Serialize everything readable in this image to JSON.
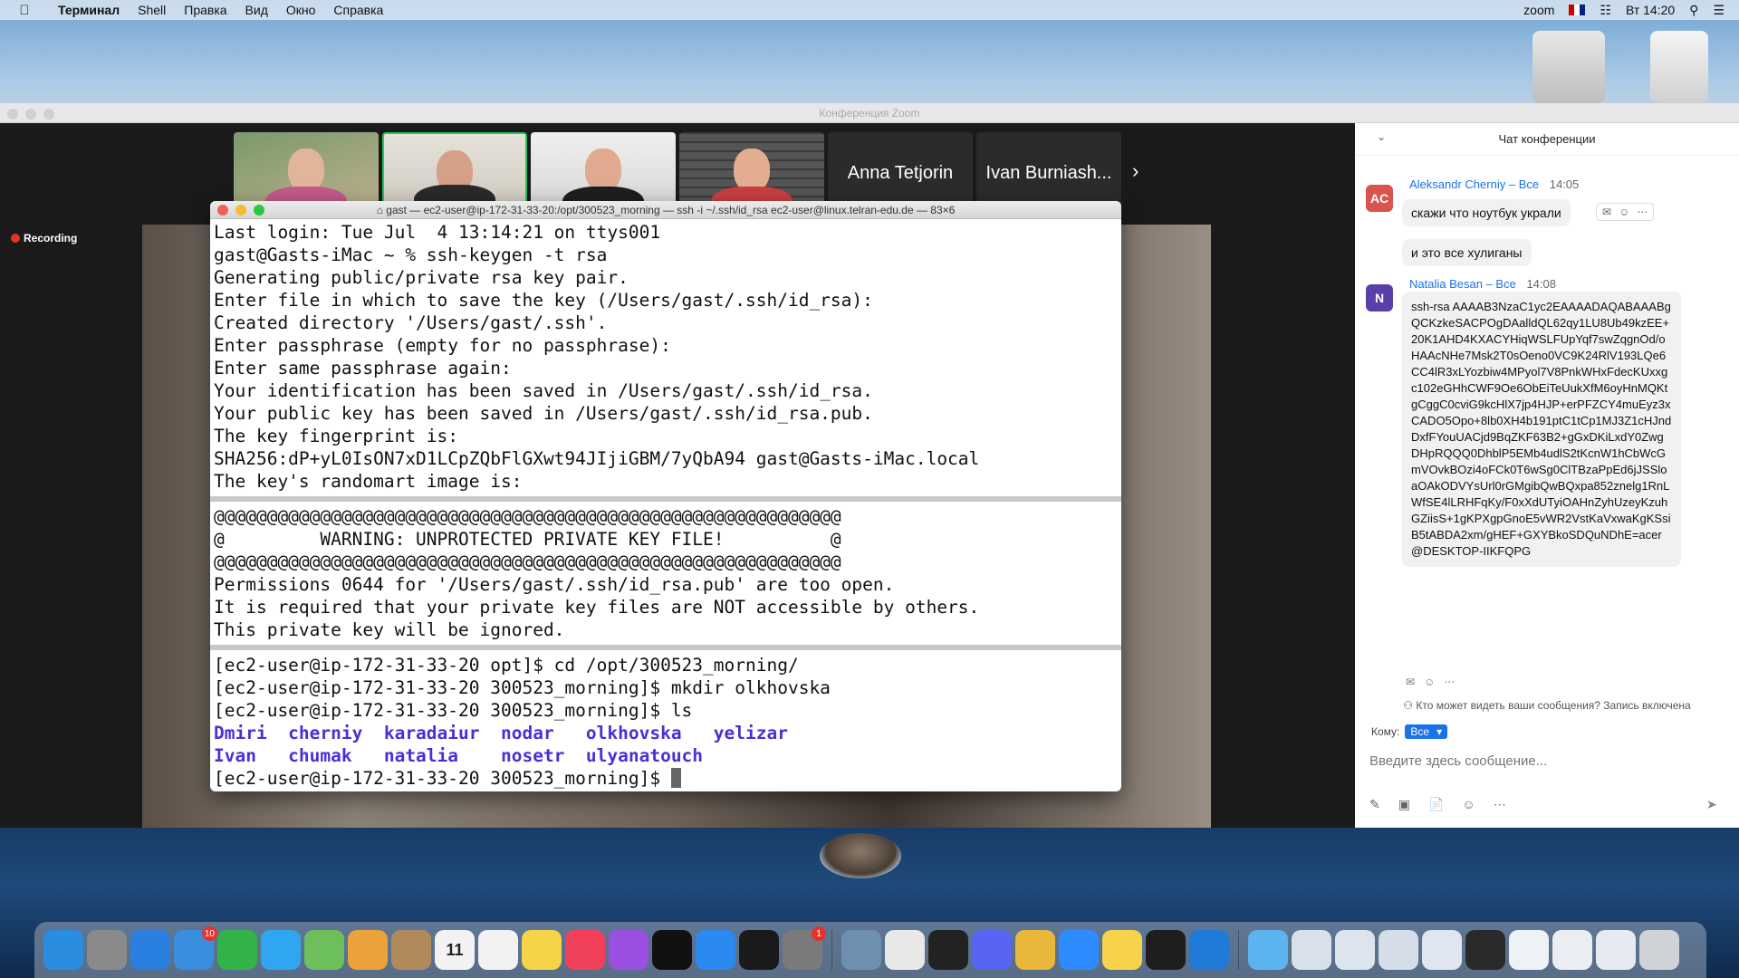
{
  "menubar": {
    "app": "Терминал",
    "items": [
      "Shell",
      "Правка",
      "Вид",
      "Окно",
      "Справка"
    ],
    "right": {
      "zoom": "zoom",
      "clock": "Вт 14:20"
    }
  },
  "zoom_window": {
    "title": "Конференция Zoom",
    "recording": "Recording",
    "participants": [
      {
        "type": "video"
      },
      {
        "type": "video",
        "active": true
      },
      {
        "type": "video"
      },
      {
        "type": "video"
      },
      {
        "type": "name",
        "name": "Anna Tetjorin"
      },
      {
        "type": "name",
        "name": "Ivan Burniash..."
      }
    ]
  },
  "terminal": {
    "title": "gast — ec2-user@ip-172-31-33-20:/opt/300523_morning — ssh -i ~/.ssh/id_rsa ec2-user@linux.telran-edu.de — 83×6",
    "section1": [
      "Last login: Tue Jul  4 13:14:21 on ttys001",
      "gast@Gasts-iMac ~ % ssh-keygen -t rsa",
      "Generating public/private rsa key pair.",
      "Enter file in which to save the key (/Users/gast/.ssh/id_rsa):",
      "Created directory '/Users/gast/.ssh'.",
      "Enter passphrase (empty for no passphrase):",
      "Enter same passphrase again:",
      "Your identification has been saved in /Users/gast/.ssh/id_rsa.",
      "Your public key has been saved in /Users/gast/.ssh/id_rsa.pub.",
      "The key fingerprint is:",
      "SHA256:dP+yL0IsON7xD1LCpZQbFlGXwt94JIjiGBM/7yQbA94 gast@Gasts-iMac.local",
      "The key's randomart image is:"
    ],
    "section2": [
      "@@@@@@@@@@@@@@@@@@@@@@@@@@@@@@@@@@@@@@@@@@@@@@@@@@@@@@@@@@@",
      "@         WARNING: UNPROTECTED PRIVATE KEY FILE!          @",
      "@@@@@@@@@@@@@@@@@@@@@@@@@@@@@@@@@@@@@@@@@@@@@@@@@@@@@@@@@@@",
      "Permissions 0644 for '/Users/gast/.ssh/id_rsa.pub' are too open.",
      "It is required that your private key files are NOT accessible by others.",
      "This private key will be ignored."
    ],
    "section3": [
      "[ec2-user@ip-172-31-33-20 opt]$ cd /opt/300523_morning/",
      "[ec2-user@ip-172-31-33-20 300523_morning]$ mkdir olkhovska",
      "[ec2-user@ip-172-31-33-20 300523_morning]$ ls"
    ],
    "ls_output": [
      "Dmiri  cherniy  karadaiur  nodar   olkhovska   yelizar",
      "Ivan   chumak   natalia    nosetr  ulyanatouch"
    ],
    "prompt": "[ec2-user@ip-172-31-33-20 300523_morning]$ "
  },
  "chat": {
    "title": "Чат конференции",
    "messages": [
      {
        "initials": "AC",
        "avatar_color": "#d9534f",
        "sender": "Aleksandr Cherniy",
        "to": "Все",
        "time": "14:05",
        "lines": [
          "скажи что ноутбук украли",
          "и это все хулиганы"
        ]
      },
      {
        "initials": "N",
        "avatar_color": "#5b3fa8",
        "sender": "Natalia Besan",
        "to": "Все",
        "time": "14:08",
        "text": "ssh-rsa AAAAB3NzaC1yc2EAAAADAQABAAABgQCKzkeSACPOgDAalldQL62qy1LU8Ub49kzEE+20K1AHD4KXACYHiqWSLFUpYqf7swZqgnOd/oHAAcNHe7Msk2T0sOeno0VC9K24RlV193LQe6CC4lR3xLYozbiw4MPyol7V8PnkWHxFdecKUxxgc102eGHhCWF9Oe6ObEiTeUukXfM6oyHnMQKtgCggC0cviG9kcHlX7jp4HJP+erPFZCY4muEyz3xCADO5Opo+8lb0XH4b191ptC1tCp1MJ3Z1cHJndDxfFYouUACjd9BqZKF63B2+gGxDKiLxdY0ZwgDHpRQQQ0DhblP5EMb4udlS2tKcnW1hCbWcGmVOvkBOzi4oFCk0T6wSg0ClTBzaPpEd6jJSSloaOAkODVYsUrl0rGMgibQwBQxpa852znelg1RnLWfSE4lLRHFqKy/F0xXdUTyiOAHnZyhUzeyKzuhGZiisS+1gKPXgpGnoE5vWR2VstKaVxwaKgKSsiB5tABDA2xm/gHEF+GXYBkoSDQuNDhE=acer@DESKTOP-IIKFQPG"
      }
    ],
    "notice": "Кто может видеть ваши сообщения? Запись включена",
    "to_label": "Кому:",
    "to_value": "Все",
    "input_placeholder": "Введите здесь сообщение..."
  },
  "dock": {
    "icons": [
      {
        "name": "finder-icon",
        "color": "#2b8de0"
      },
      {
        "name": "launchpad-icon",
        "color": "#8a8a8a"
      },
      {
        "name": "safari-icon",
        "color": "#2a7fe0"
      },
      {
        "name": "mail-icon",
        "color": "#3b8de0",
        "badge": "10"
      },
      {
        "name": "facetime-icon",
        "color": "#32b34a"
      },
      {
        "name": "messages-icon",
        "color": "#31a6f0"
      },
      {
        "name": "maps-icon",
        "color": "#6cbf5a"
      },
      {
        "name": "photos-icon",
        "color": "#e9a33a"
      },
      {
        "name": "contacts-icon",
        "color": "#b08a5a"
      },
      {
        "name": "calendar-icon",
        "color": "#f2f2f2",
        "label": "11"
      },
      {
        "name": "reminders-icon",
        "color": "#f2f2f2"
      },
      {
        "name": "notes-icon",
        "color": "#f5d547"
      },
      {
        "name": "music-icon",
        "color": "#f0405a"
      },
      {
        "name": "podcasts-icon",
        "color": "#9b4fe0"
      },
      {
        "name": "appletv-icon",
        "color": "#111111"
      },
      {
        "name": "appstore-icon",
        "color": "#2a8af0"
      },
      {
        "name": "intellij-icon",
        "color": "#1a1a1a"
      },
      {
        "name": "system-preferences-icon",
        "color": "#7a7a7a",
        "badge": "1"
      },
      {
        "name": "preview-icon",
        "color": "#6d8fb0"
      },
      {
        "name": "textedit-icon",
        "color": "#e8e8e8"
      },
      {
        "name": "terminal-icon",
        "color": "#222222"
      },
      {
        "name": "discord-icon",
        "color": "#5865f2"
      },
      {
        "name": "chrome-icon",
        "color": "#e9b83a"
      },
      {
        "name": "zoom-icon",
        "color": "#2d8cff"
      },
      {
        "name": "stickies-icon",
        "color": "#f7d24b"
      },
      {
        "name": "figma-icon",
        "color": "#1e1e1e"
      },
      {
        "name": "vscode-icon",
        "color": "#1f7ad8"
      },
      {
        "name": "downloads-folder-icon",
        "color": "#5bb3f0"
      },
      {
        "name": "window-thumbnail-1-icon",
        "color": "#d8e0ea"
      },
      {
        "name": "window-thumbnail-2-icon",
        "color": "#dce4ee"
      },
      {
        "name": "window-thumbnail-3-icon",
        "color": "#d4dde8"
      },
      {
        "name": "window-thumbnail-4-icon",
        "color": "#e0e6ef"
      },
      {
        "name": "window-thumbnail-5-icon",
        "color": "#2a2a2a"
      },
      {
        "name": "window-thumbnail-6-icon",
        "color": "#eef2f6"
      },
      {
        "name": "window-thumbnail-7-icon",
        "color": "#eaeef3"
      },
      {
        "name": "window-thumbnail-8-icon",
        "color": "#e6ebf1"
      },
      {
        "name": "trash-icon",
        "color": "#cfd3d8"
      }
    ]
  }
}
